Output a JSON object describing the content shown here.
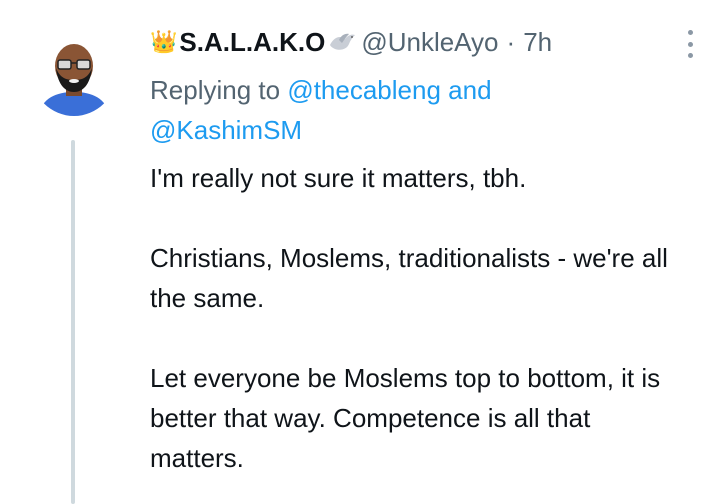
{
  "tweet": {
    "author": {
      "crown_icon": "crown-emoji",
      "display_name": "S.A.L.A.K.O",
      "dove_icon": "dove-emoji",
      "handle": "@UnkleAyo",
      "separator": "·",
      "time": "7h"
    },
    "reply": {
      "prefix": "Replying to",
      "mention1": "@thecableng",
      "conjunction": "and",
      "mention2": "@KashimSM"
    },
    "body": [
      "I'm really not sure it matters, tbh.",
      "Christians, Moslems, traditionalists - we're all the same.",
      "Let everyone be Moslems top to bottom, it is better that way. Competence is all that matters."
    ]
  },
  "colors": {
    "link": "#1d9bf0",
    "secondary_text": "#536471",
    "thread_line": "#cfd9de"
  }
}
